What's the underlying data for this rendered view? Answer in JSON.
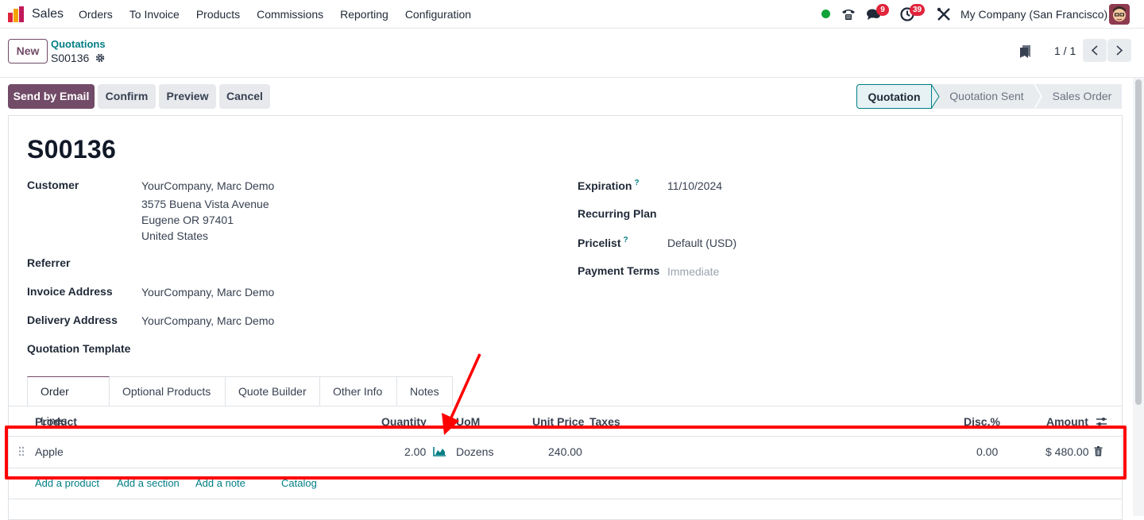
{
  "navbar": {
    "app_name": "Sales",
    "menu": [
      "Orders",
      "To Invoice",
      "Products",
      "Commissions",
      "Reporting",
      "Configuration"
    ],
    "messages_badge": "9",
    "activities_badge": "39",
    "company": "My Company (San Francisco)"
  },
  "control_panel": {
    "new_label": "New",
    "breadcrumb_parent": "Quotations",
    "breadcrumb_current": "S00136",
    "pager": "1 / 1"
  },
  "actions": {
    "send_email": "Send by Email",
    "confirm": "Confirm",
    "preview": "Preview",
    "cancel": "Cancel"
  },
  "statusbar": {
    "stages": [
      "Quotation",
      "Quotation Sent",
      "Sales Order"
    ],
    "active": "Quotation"
  },
  "form": {
    "name": "S00136",
    "customer_label": "Customer",
    "customer_lines": [
      "YourCompany, Marc Demo",
      "3575 Buena Vista Avenue",
      "Eugene OR 97401",
      "United States"
    ],
    "referrer_label": "Referrer",
    "invoice_address_label": "Invoice Address",
    "invoice_address": "YourCompany, Marc Demo",
    "delivery_address_label": "Delivery Address",
    "delivery_address": "YourCompany, Marc Demo",
    "quotation_template_label": "Quotation Template",
    "expiration_label": "Expiration",
    "expiration": "11/10/2024",
    "recurring_plan_label": "Recurring Plan",
    "pricelist_label": "Pricelist",
    "pricelist": "Default (USD)",
    "payment_terms_label": "Payment Terms",
    "payment_terms_placeholder": "Immediate",
    "help_mark": "?"
  },
  "tabs": [
    "Order Lines",
    "Optional Products",
    "Quote Builder",
    "Other Info",
    "Notes"
  ],
  "order_table": {
    "headers": {
      "product": "Product",
      "quantity": "Quantity",
      "uom": "UoM",
      "unit_price": "Unit Price",
      "taxes": "Taxes",
      "discount": "Disc.%",
      "amount": "Amount"
    },
    "rows": [
      {
        "product": "Apple",
        "quantity": "2.00",
        "uom": "Dozens",
        "unit_price": "240.00",
        "taxes": "",
        "discount": "0.00",
        "amount": "$ 480.00"
      }
    ],
    "links": {
      "add_product": "Add a product",
      "add_section": "Add a section",
      "add_note": "Add a note",
      "catalog": "Catalog"
    }
  },
  "colors": {
    "brand": "#714b67",
    "link": "#017e84",
    "annotation": "#ff0000"
  }
}
